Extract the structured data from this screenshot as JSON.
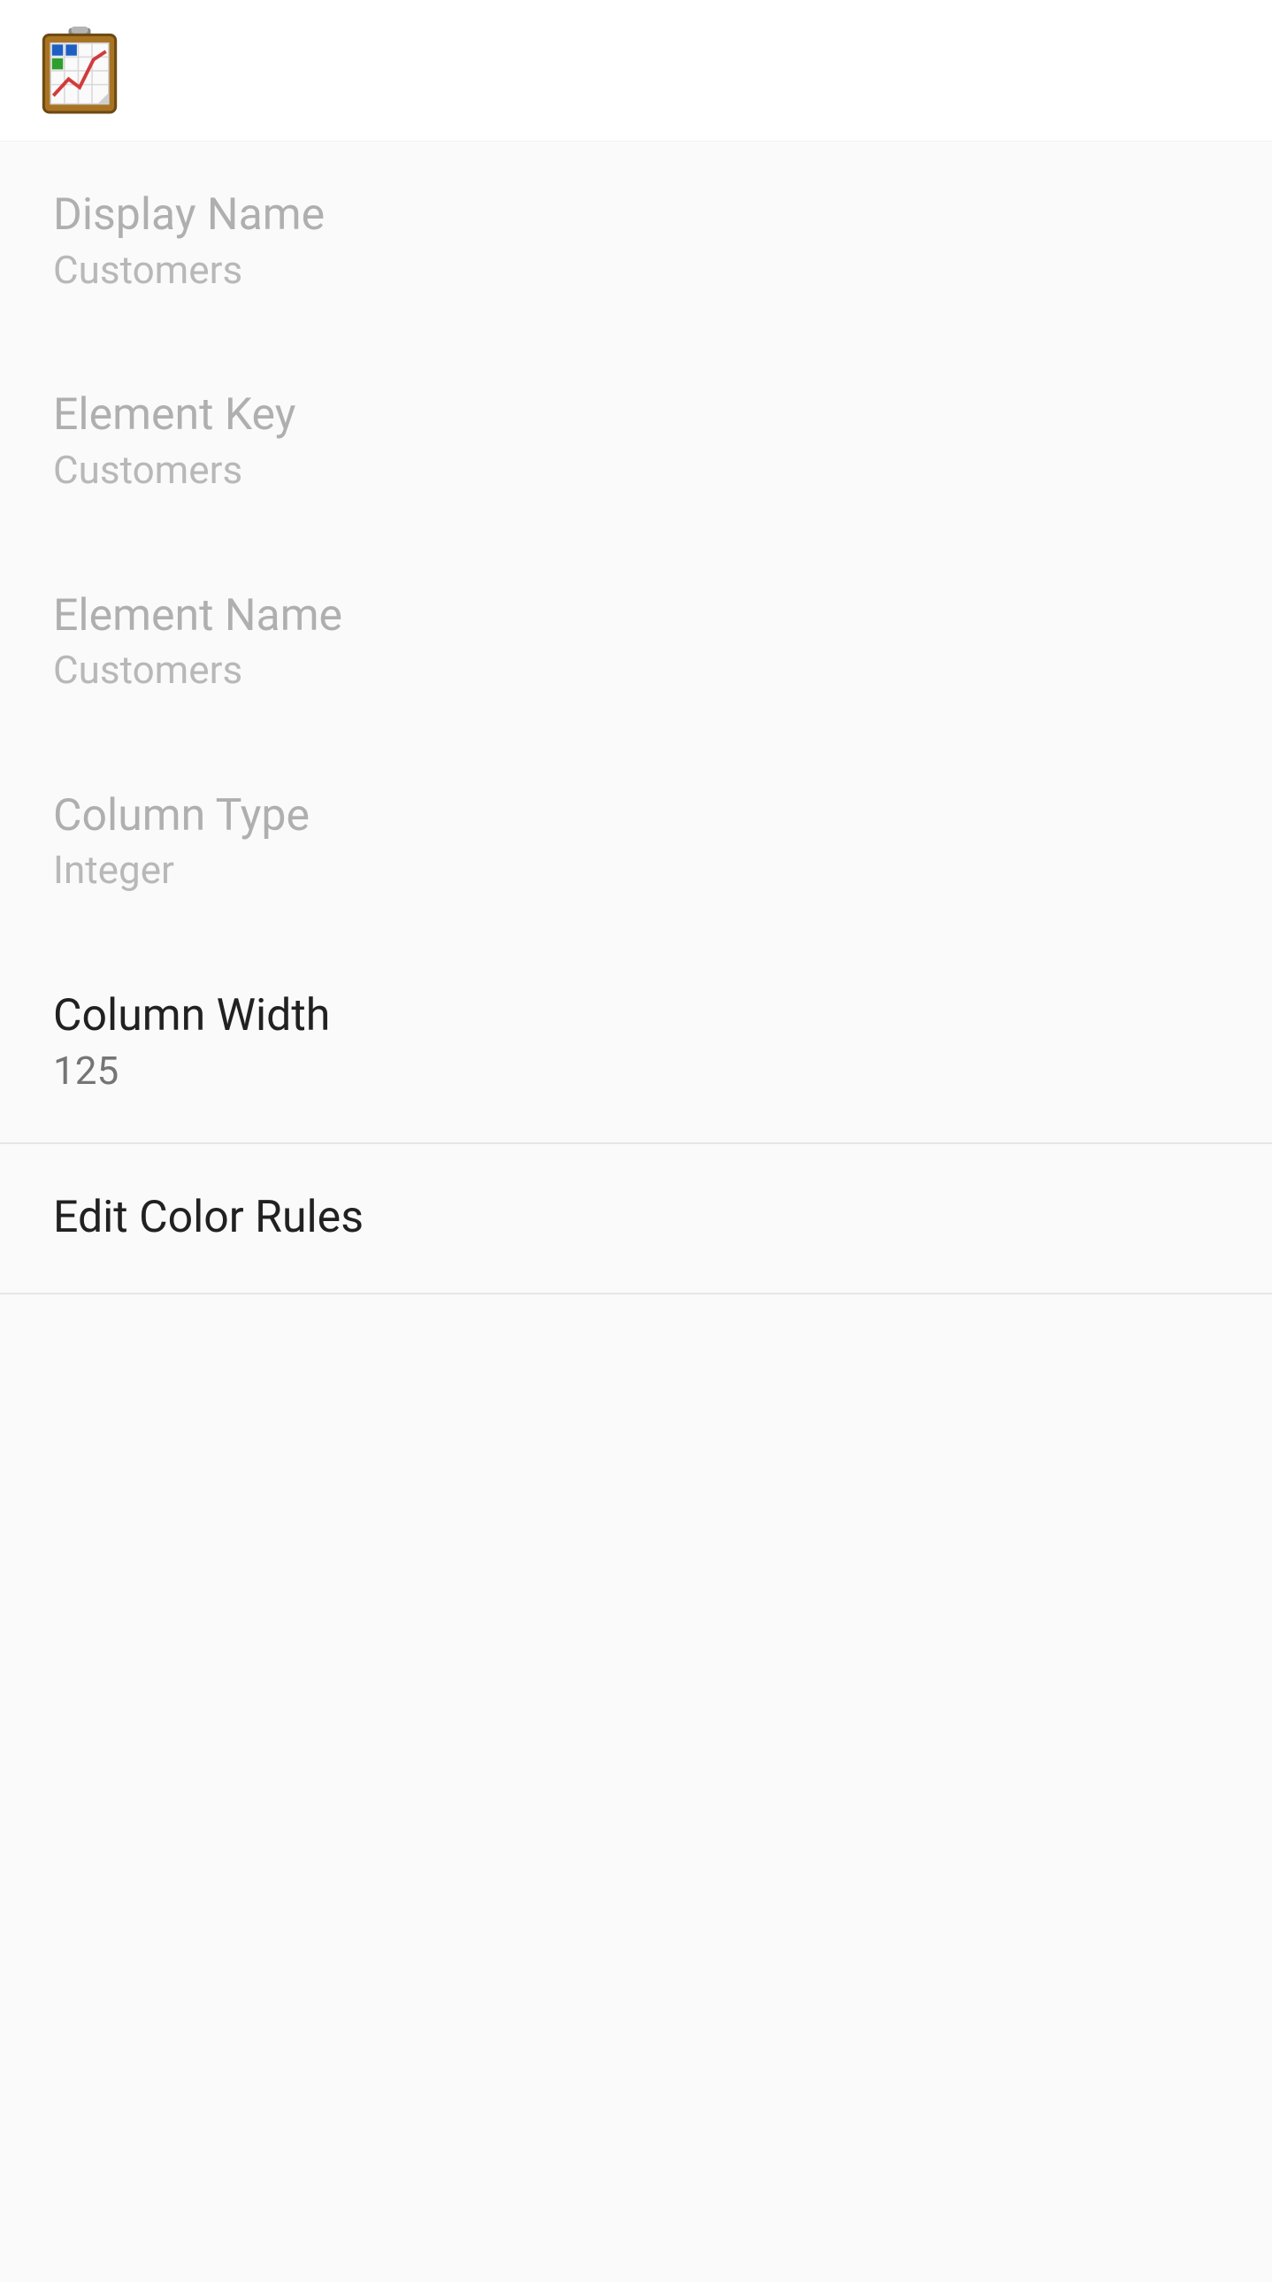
{
  "prefs": {
    "displayName": {
      "title": "Display Name",
      "summary": "Customers"
    },
    "elementKey": {
      "title": "Element Key",
      "summary": "Customers"
    },
    "elementName": {
      "title": "Element Name",
      "summary": "Customers"
    },
    "columnType": {
      "title": "Column Type",
      "summary": "Integer"
    },
    "columnWidth": {
      "title": "Column Width",
      "summary": "125"
    },
    "editColorRules": {
      "title": "Edit Color Rules"
    }
  }
}
